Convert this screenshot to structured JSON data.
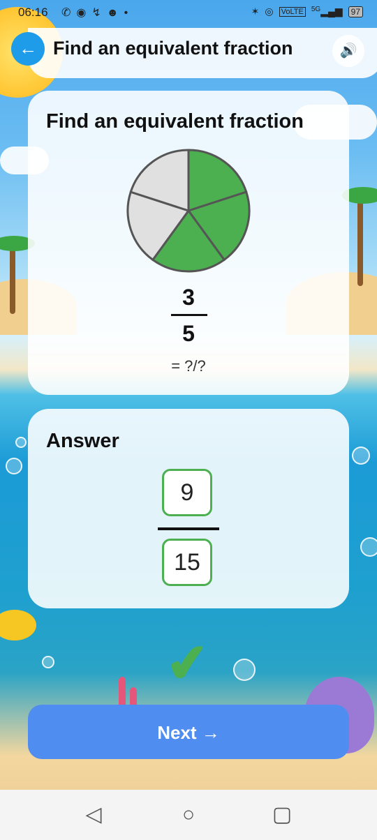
{
  "status_bar": {
    "time": "06:16",
    "left_icons": [
      "whatsapp-icon",
      "chat-icon",
      "missed-call-icon",
      "face-icon",
      "dot-icon"
    ],
    "right_icons": [
      "bluetooth-icon",
      "hotspot-icon",
      "volte-icon",
      "5g-signal-icon"
    ],
    "volte_label": "VoLTE",
    "network_label": "5G",
    "battery": "97"
  },
  "header": {
    "title": "Find an equivalent fraction",
    "back_icon": "back-arrow-icon",
    "sound_icon": "speaker-icon"
  },
  "question": {
    "title": "Find an equivalent fraction",
    "pie": {
      "total_parts": 5,
      "shaded_parts": 3,
      "shaded_color": "#4caf50",
      "unshaded_color": "#e0e0e0"
    },
    "numerator": "3",
    "denominator": "5",
    "prompt": "= ?/?"
  },
  "answer": {
    "title": "Answer",
    "numerator": "9",
    "denominator": "15",
    "correct": true,
    "box_color": "#4caf50"
  },
  "buttons": {
    "next_label": "Next →"
  },
  "colors": {
    "accent": "#1e9be9",
    "next_button": "#4f8df0",
    "correct": "#4caf50"
  },
  "nav_bar": [
    "back-icon",
    "home-icon",
    "recents-icon"
  ]
}
